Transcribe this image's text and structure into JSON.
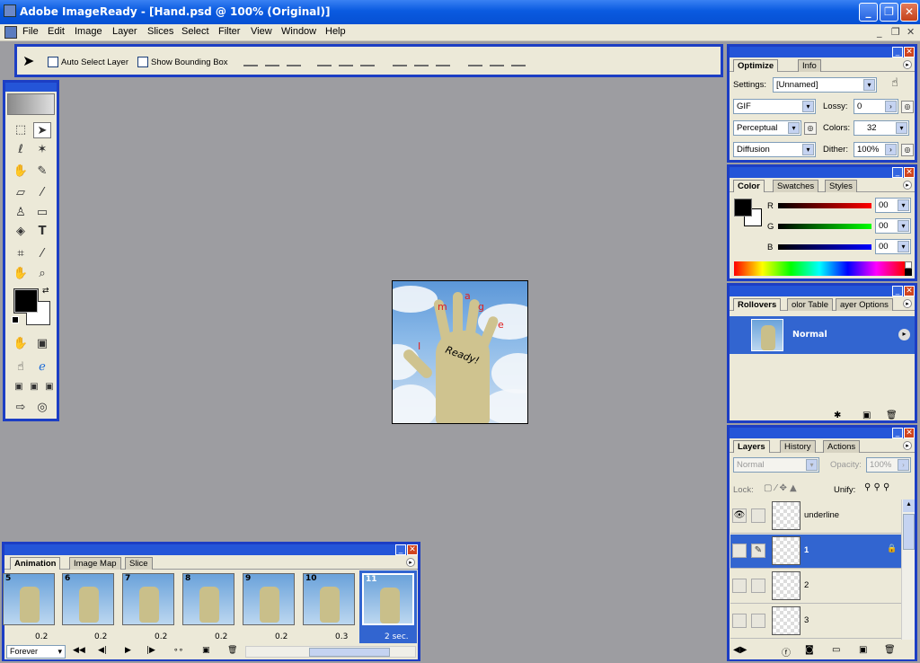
{
  "window": {
    "title": "Adobe ImageReady - [Hand.psd @ 100% (Original)]"
  },
  "menu": [
    "File",
    "Edit",
    "Image",
    "Layer",
    "Slices",
    "Select",
    "Filter",
    "View",
    "Window",
    "Help"
  ],
  "options": {
    "auto_select": "Auto Select Layer",
    "bounding_box": "Show Bounding Box"
  },
  "optimize": {
    "tabs": [
      "Optimize",
      "Info"
    ],
    "settings_label": "Settings:",
    "settings_value": "[Unnamed]",
    "format": "GIF",
    "lossy_label": "Lossy:",
    "lossy_value": "0",
    "reduction": "Perceptual",
    "colors_label": "Colors:",
    "colors_value": "32",
    "dither_alg": "Diffusion",
    "dither_label": "Dither:",
    "dither_value": "100%"
  },
  "color": {
    "tabs": [
      "Color",
      "Swatches",
      "Styles"
    ],
    "channels": [
      {
        "name": "R",
        "value": "00",
        "color": "#d00000"
      },
      {
        "name": "G",
        "value": "00",
        "color": "#00b000"
      },
      {
        "name": "B",
        "value": "00",
        "color": "#0000d0"
      }
    ]
  },
  "rollovers": {
    "tabs": [
      "Rollovers",
      "olor Table",
      "ayer Options"
    ],
    "state": "Normal"
  },
  "layers": {
    "tabs": [
      "Layers",
      "History",
      "Actions"
    ],
    "blend": "Normal",
    "opacity_label": "Opacity:",
    "opacity_value": "100%",
    "lock_label": "Lock:",
    "unify_label": "Unify:",
    "rows": [
      {
        "name": "underline"
      },
      {
        "name": "1"
      },
      {
        "name": "2"
      },
      {
        "name": "3"
      }
    ]
  },
  "animation": {
    "tabs": [
      "Animation",
      "Image Map",
      "Slice"
    ],
    "frames": [
      {
        "num": "5",
        "delay": "0.2"
      },
      {
        "num": "6",
        "delay": "0.2"
      },
      {
        "num": "7",
        "delay": "0.2"
      },
      {
        "num": "8",
        "delay": "0.2"
      },
      {
        "num": "9",
        "delay": "0.2"
      },
      {
        "num": "10",
        "delay": "0.3"
      },
      {
        "num": "11",
        "delay": "2 sec."
      }
    ],
    "loop": "Forever"
  },
  "canvas": {
    "letters": [
      "I",
      "m",
      "a",
      "g",
      "e"
    ],
    "word": "Ready!"
  }
}
